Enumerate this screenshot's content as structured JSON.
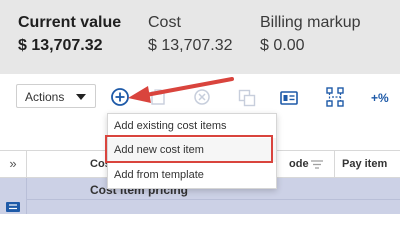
{
  "summary": {
    "current_value": {
      "label": "Current value",
      "value": "$ 13,707.32"
    },
    "cost": {
      "label": "Cost",
      "value": "$ 13,707.32"
    },
    "billing_markup": {
      "label": "Billing markup",
      "value": "$ 0.00"
    }
  },
  "toolbar": {
    "actions_label": "Actions",
    "percent_label": "+%",
    "icons": [
      "add-circle-icon",
      "paste-icon",
      "cancel-circle-icon",
      "copy-icon",
      "card-view-icon",
      "hierarchy-icon"
    ]
  },
  "dropdown_menu": {
    "items": [
      {
        "label": "Add existing cost items"
      },
      {
        "label": "Add new cost item"
      },
      {
        "label": "Add from template"
      }
    ],
    "highlighted_index": 1
  },
  "grid": {
    "columns": [
      {
        "label": "Cos"
      },
      {
        "label": "ode"
      },
      {
        "label": "Pay item"
      }
    ],
    "group_row": {
      "title": "Cost item pricing"
    }
  },
  "colors": {
    "accent_blue": "#1e5aa8",
    "annotation_red": "#d9443d",
    "summary_bg": "#e7e7e7",
    "group_row_bg": "#ccd1e6"
  }
}
